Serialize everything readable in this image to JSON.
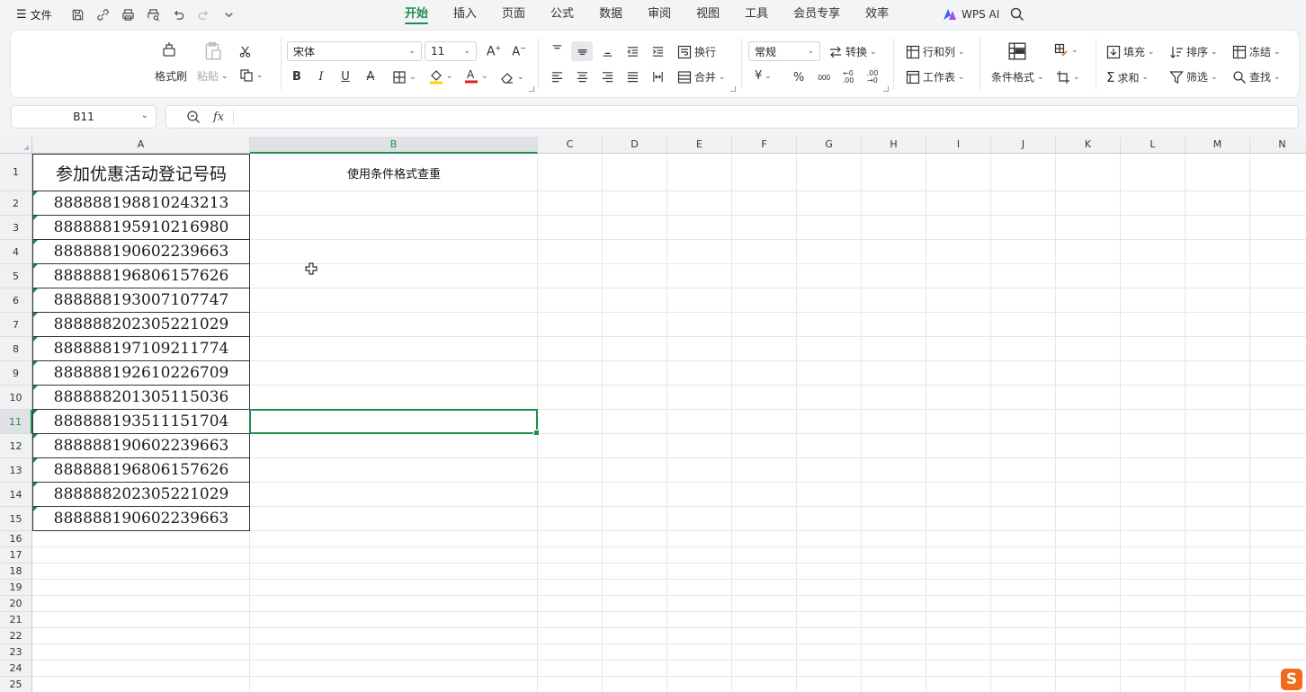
{
  "menubar": {
    "file_label": "文件",
    "tabs": [
      "开始",
      "插入",
      "页面",
      "公式",
      "数据",
      "审阅",
      "视图",
      "工具",
      "会员专享",
      "效率"
    ],
    "active_tab": "开始",
    "wps_ai_label": "WPS AI"
  },
  "ribbon": {
    "format_painter": "格式刷",
    "paste": "粘贴",
    "font_name": "宋体",
    "font_size": "11",
    "wrap_text": "换行",
    "merge": "合并",
    "number_format": "常规",
    "convert": "转换",
    "rows_cols": "行和列",
    "worksheet": "工作表",
    "conditional_format": "条件格式",
    "fill": "填充",
    "sort": "排序",
    "freeze": "冻结",
    "sum": "求和",
    "filter": "筛选",
    "find": "查找",
    "currency_symbol": "¥",
    "percent_symbol": "%",
    "thousands_symbol": "000"
  },
  "formula_bar": {
    "name_box": "B11",
    "fx_label": "fx",
    "formula": ""
  },
  "sheet": {
    "columns": [
      "A",
      "B",
      "C",
      "D",
      "E",
      "F",
      "G",
      "H",
      "I",
      "J",
      "K",
      "L",
      "M",
      "N"
    ],
    "rows": [
      "1",
      "2",
      "3",
      "4",
      "5",
      "6",
      "7",
      "8",
      "9",
      "10",
      "11",
      "12",
      "13",
      "14",
      "15",
      "16",
      "17",
      "18",
      "19",
      "20",
      "21",
      "22",
      "23",
      "24",
      "25"
    ],
    "selected_cell": "B11",
    "a1_header": "参加优惠活动登记号码",
    "b1_header": "使用条件格式查重",
    "a_values": [
      "888888198810243213",
      "888888195910216980",
      "888888190602239663",
      "888888196806157626",
      "888888193007107747",
      "888888202305221029",
      "888888197109211774",
      "888888192610226709",
      "888888201305115036",
      "888888193511151704",
      "888888190602239663",
      "888888196806157626",
      "888888202305221029",
      "888888190602239663"
    ]
  },
  "colors": {
    "accent": "#1d8f4f",
    "font_color_bar": "#e02020",
    "highlight_bar": "#ffd600"
  }
}
